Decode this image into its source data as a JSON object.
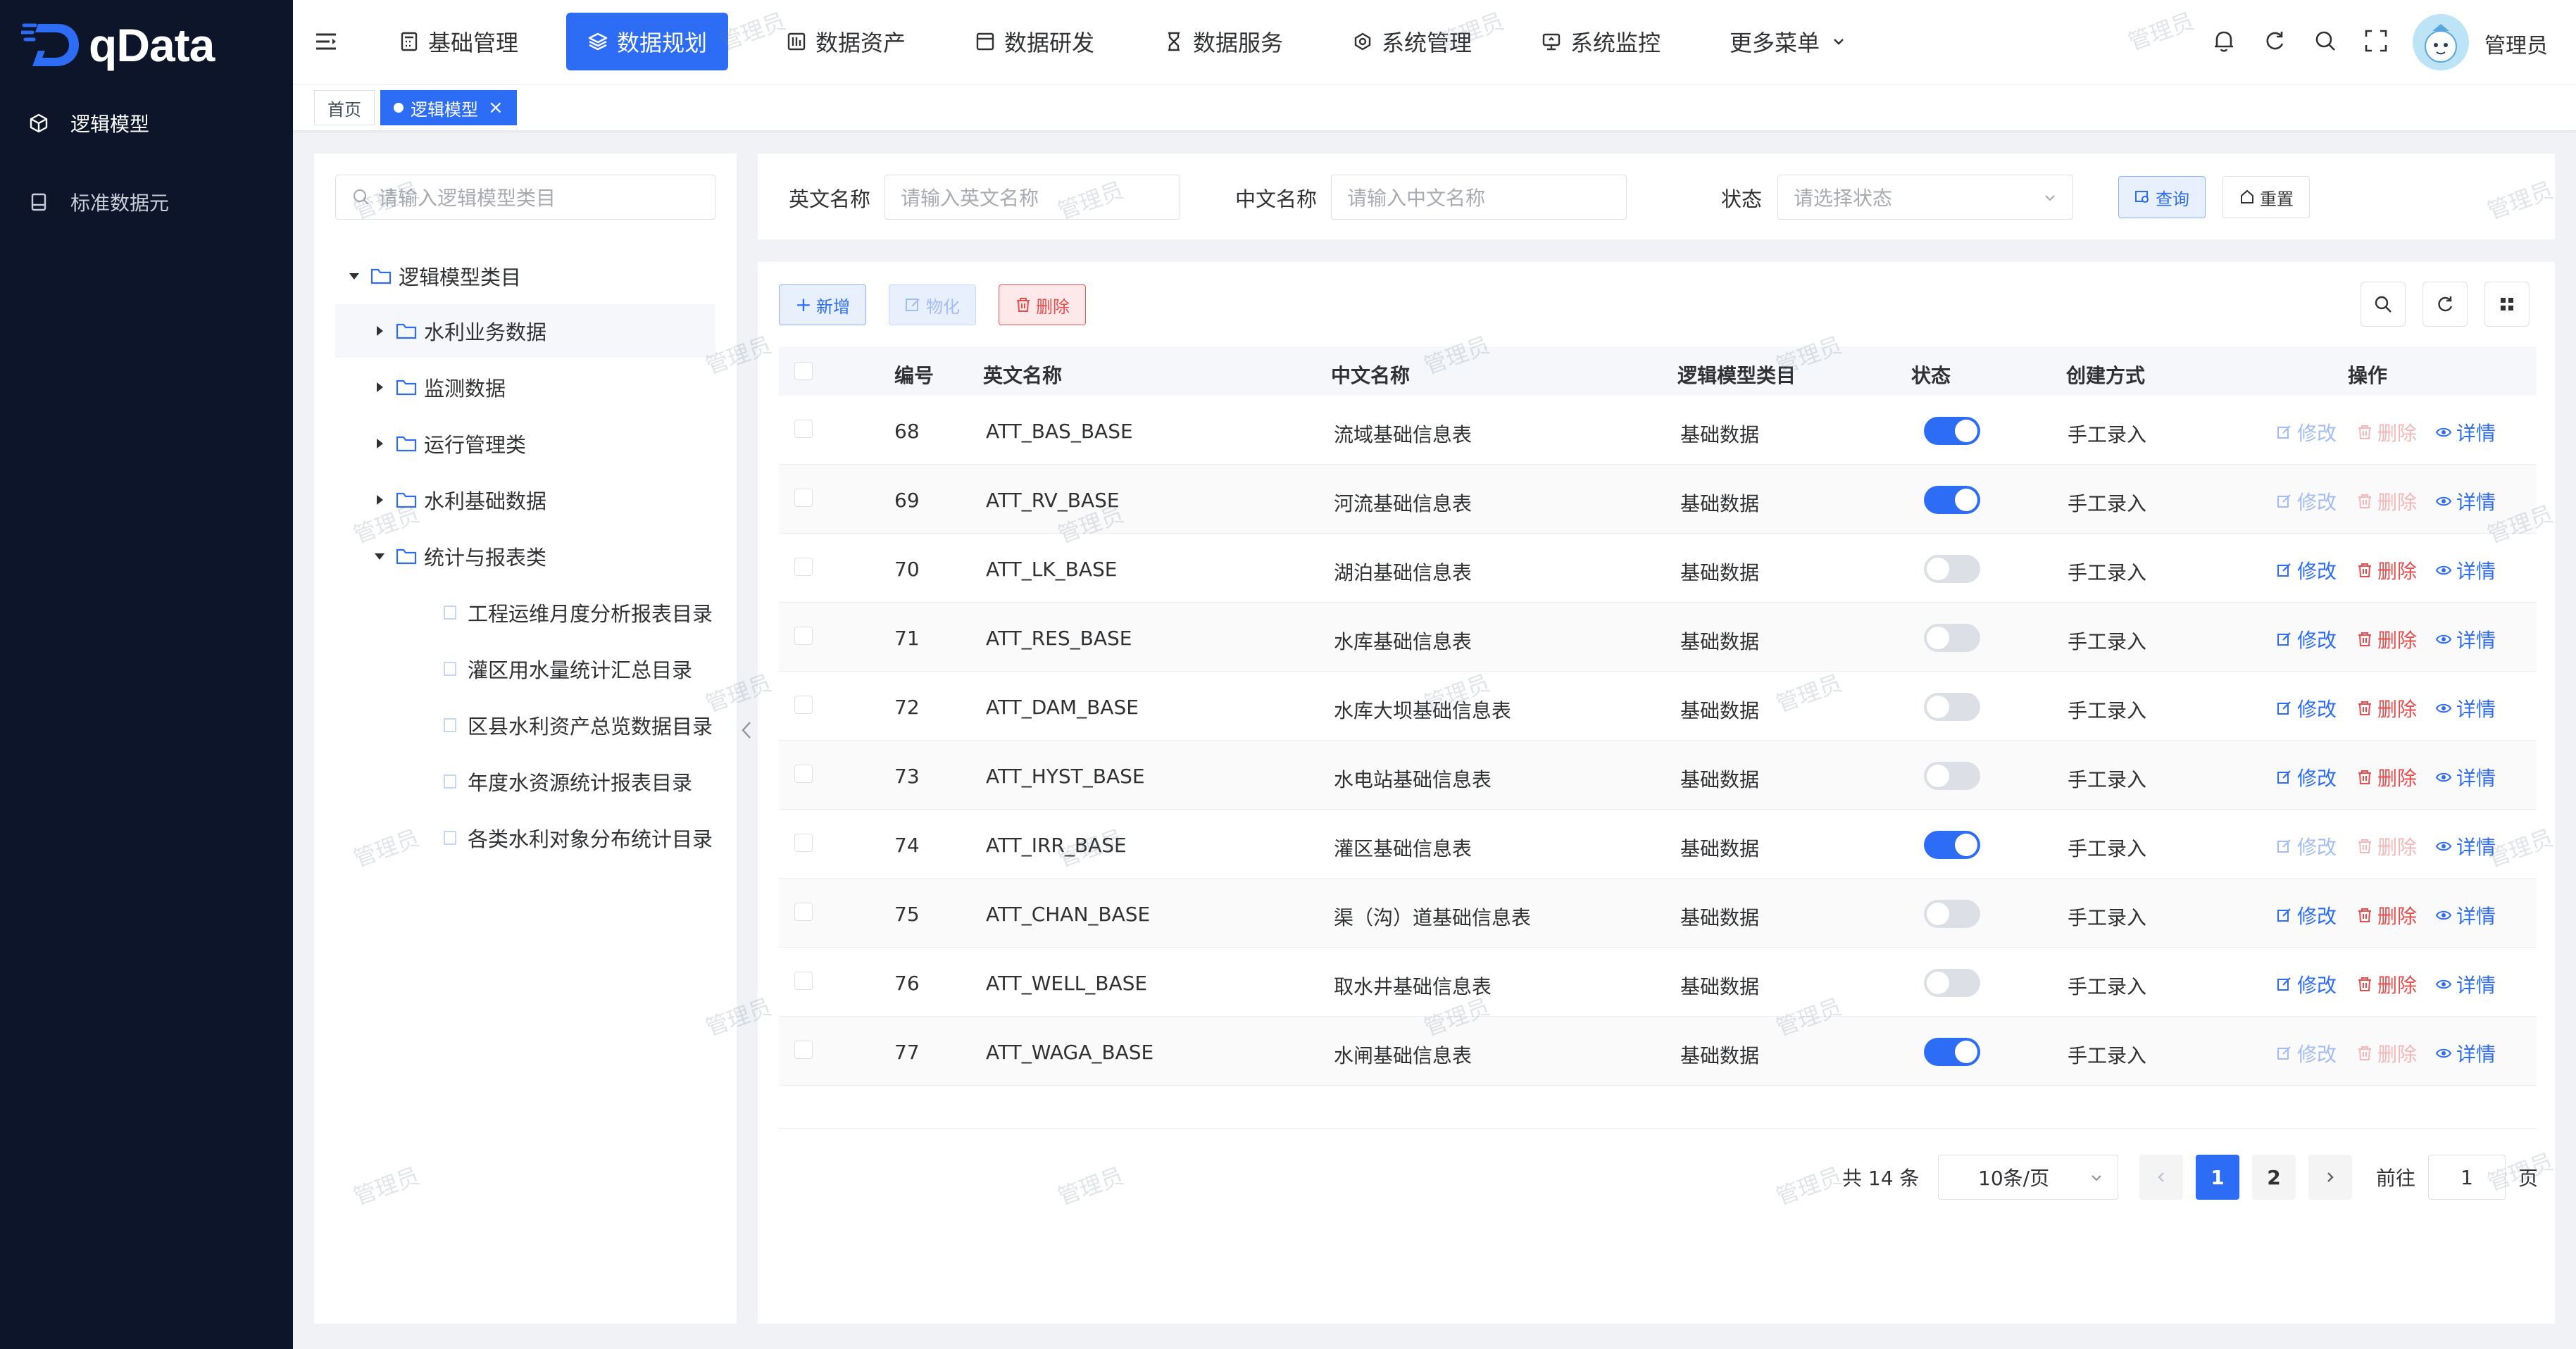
{
  "app": {
    "logo_text": "qData"
  },
  "sidebar": {
    "items": [
      {
        "label": "逻辑模型",
        "icon": "cube-icon"
      },
      {
        "label": "标准数据元",
        "icon": "database-icon"
      }
    ]
  },
  "nav": {
    "items": [
      {
        "label": "基础管理",
        "icon": "calculator-icon"
      },
      {
        "label": "数据规划",
        "icon": "layers-icon"
      },
      {
        "label": "数据资产",
        "icon": "asset-icon"
      },
      {
        "label": "数据研发",
        "icon": "window-icon"
      },
      {
        "label": "数据服务",
        "icon": "hourglass-icon"
      },
      {
        "label": "系统管理",
        "icon": "gear-icon"
      },
      {
        "label": "系统监控",
        "icon": "monitor-icon"
      },
      {
        "label": "更多菜单",
        "icon": "chevron-down-icon"
      }
    ],
    "active": "数据规划"
  },
  "user": {
    "name": "管理员"
  },
  "tabs": [
    {
      "label": "首页"
    },
    {
      "label": "逻辑模型"
    }
  ],
  "tree": {
    "search_placeholder": "请输入逻辑模型类目",
    "root": "逻辑模型类目",
    "children": [
      {
        "label": "水利业务数据"
      },
      {
        "label": "监测数据"
      },
      {
        "label": "运行管理类"
      },
      {
        "label": "水利基础数据"
      },
      {
        "label": "统计与报表类"
      }
    ],
    "leaves": [
      {
        "label": "工程运维月度分析报表目录"
      },
      {
        "label": "灌区用水量统计汇总目录"
      },
      {
        "label": "区县水利资产总览数据目录"
      },
      {
        "label": "年度水资源统计报表目录"
      },
      {
        "label": "各类水利对象分布统计目录"
      }
    ]
  },
  "search": {
    "en_label": "英文名称",
    "en_placeholder": "请输入英文名称",
    "cn_label": "中文名称",
    "cn_placeholder": "请输入中文名称",
    "status_label": "状态",
    "status_placeholder": "请选择状态",
    "query_label": "查询",
    "reset_label": "重置"
  },
  "toolbar": {
    "add_label": "新增",
    "materialize_label": "物化",
    "delete_label": "删除"
  },
  "table": {
    "headers": [
      "编号",
      "英文名称",
      "中文名称",
      "逻辑模型类目",
      "状态",
      "创建方式",
      "操作"
    ],
    "action_edit": "修改",
    "action_delete": "删除",
    "action_detail": "详情",
    "rows": [
      {
        "id": "68",
        "en": "ATT_BAS_BASE",
        "cn": "流域基础信息表",
        "category": "基础数据",
        "status_on": true,
        "method": "手工录入"
      },
      {
        "id": "69",
        "en": "ATT_RV_BASE",
        "cn": "河流基础信息表",
        "category": "基础数据",
        "status_on": true,
        "method": "手工录入"
      },
      {
        "id": "70",
        "en": "ATT_LK_BASE",
        "cn": "湖泊基础信息表",
        "category": "基础数据",
        "status_on": false,
        "method": "手工录入"
      },
      {
        "id": "71",
        "en": "ATT_RES_BASE",
        "cn": "水库基础信息表",
        "category": "基础数据",
        "status_on": false,
        "method": "手工录入"
      },
      {
        "id": "72",
        "en": "ATT_DAM_BASE",
        "cn": "水库大坝基础信息表",
        "category": "基础数据",
        "status_on": false,
        "method": "手工录入"
      },
      {
        "id": "73",
        "en": "ATT_HYST_BASE",
        "cn": "水电站基础信息表",
        "category": "基础数据",
        "status_on": false,
        "method": "手工录入"
      },
      {
        "id": "74",
        "en": "ATT_IRR_BASE",
        "cn": "灌区基础信息表",
        "category": "基础数据",
        "status_on": true,
        "method": "手工录入"
      },
      {
        "id": "75",
        "en": "ATT_CHAN_BASE",
        "cn": "渠（沟）道基础信息表",
        "category": "基础数据",
        "status_on": false,
        "method": "手工录入"
      },
      {
        "id": "76",
        "en": "ATT_WELL_BASE",
        "cn": "取水井基础信息表",
        "category": "基础数据",
        "status_on": false,
        "method": "手工录入"
      },
      {
        "id": "77",
        "en": "ATT_WAGA_BASE",
        "cn": "水闸基础信息表",
        "category": "基础数据",
        "status_on": true,
        "method": "手工录入"
      }
    ]
  },
  "pagination": {
    "total_text": "共 14 条",
    "page_size": "10条/页",
    "pages": [
      "1",
      "2"
    ],
    "current": "1",
    "goto_label": "前往",
    "goto_value": "1",
    "page_suffix": "页"
  },
  "watermark": "管理员",
  "colors": {
    "primary": "#2d6cf5",
    "sidebar": "#0c1529",
    "danger": "#e84c4c"
  }
}
